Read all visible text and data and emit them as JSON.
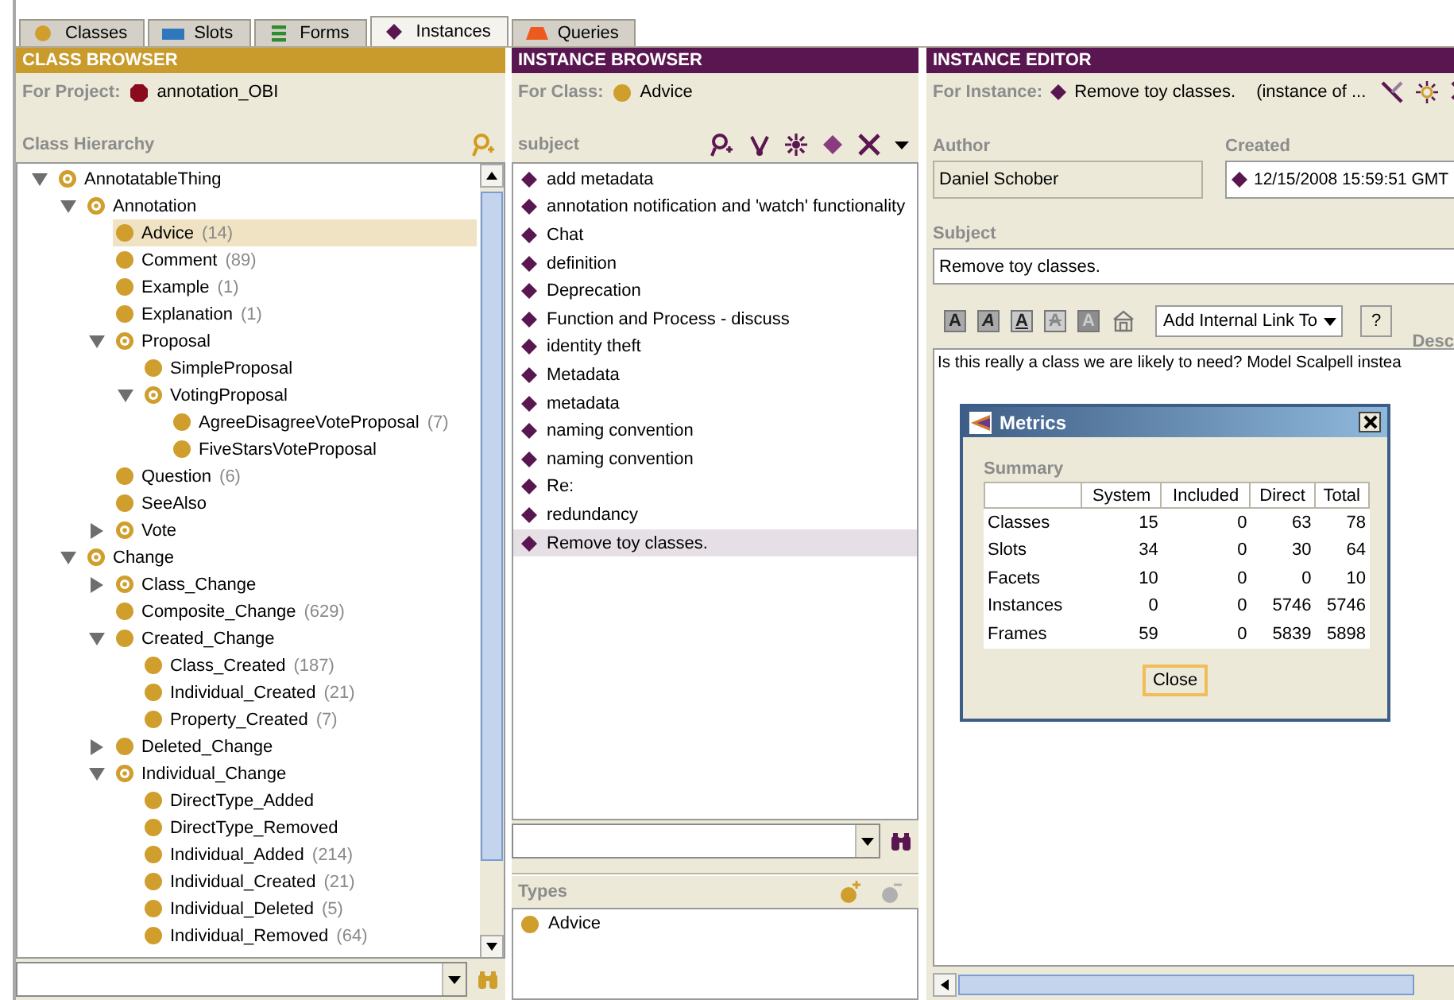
{
  "tabs": [
    {
      "label": "Classes",
      "kind": "classes",
      "selected": false
    },
    {
      "label": "Slots",
      "kind": "slots",
      "selected": false
    },
    {
      "label": "Forms",
      "kind": "forms",
      "selected": false
    },
    {
      "label": "Instances",
      "kind": "instances",
      "selected": true
    },
    {
      "label": "Queries",
      "kind": "queries",
      "selected": false
    }
  ],
  "class_browser": {
    "title": "CLASS BROWSER",
    "project_label": "For Project:",
    "project": "annotation_OBI",
    "hierarchy_label": "Class Hierarchy",
    "tree": [
      {
        "name": "AnnotatableThing",
        "abstract": true,
        "expanded": true,
        "selected": false,
        "children": [
          {
            "name": "Annotation",
            "abstract": true,
            "expanded": true,
            "selected": false,
            "children": [
              {
                "name": "Advice",
                "count": "(14)",
                "abstract": false,
                "selected": true
              },
              {
                "name": "Comment",
                "count": "(89)",
                "abstract": false,
                "selected": false
              },
              {
                "name": "Example",
                "count": "(1)",
                "abstract": false,
                "selected": false
              },
              {
                "name": "Explanation",
                "count": "(1)",
                "abstract": false,
                "selected": false
              },
              {
                "name": "Proposal",
                "abstract": true,
                "expanded": true,
                "selected": false,
                "children": [
                  {
                    "name": "SimpleProposal",
                    "abstract": false,
                    "selected": false
                  },
                  {
                    "name": "VotingProposal",
                    "abstract": true,
                    "expanded": true,
                    "selected": false,
                    "children": [
                      {
                        "name": "AgreeDisagreeVoteProposal",
                        "count": "(7)",
                        "abstract": false,
                        "selected": false
                      },
                      {
                        "name": "FiveStarsVoteProposal",
                        "abstract": false,
                        "selected": false
                      }
                    ]
                  }
                ]
              },
              {
                "name": "Question",
                "count": "(6)",
                "abstract": false,
                "selected": false
              },
              {
                "name": "SeeAlso",
                "abstract": false,
                "selected": false
              },
              {
                "name": "Vote",
                "abstract": true,
                "expanded": false,
                "selected": false
              }
            ]
          },
          {
            "name": "Change",
            "abstract": true,
            "expanded": true,
            "selected": false,
            "children": [
              {
                "name": "Class_Change",
                "abstract": true,
                "expanded": false,
                "selected": false
              },
              {
                "name": "Composite_Change",
                "count": "(629)",
                "abstract": false,
                "selected": false
              },
              {
                "name": "Created_Change",
                "abstract": false,
                "expanded": true,
                "selected": false,
                "children": [
                  {
                    "name": "Class_Created",
                    "count": "(187)",
                    "abstract": false,
                    "selected": false
                  },
                  {
                    "name": "Individual_Created",
                    "count": "(21)",
                    "abstract": false,
                    "selected": false
                  },
                  {
                    "name": "Property_Created",
                    "count": "(7)",
                    "abstract": false,
                    "selected": false
                  }
                ]
              },
              {
                "name": "Deleted_Change",
                "abstract": false,
                "expanded": false,
                "selected": false
              },
              {
                "name": "Individual_Change",
                "abstract": true,
                "expanded": true,
                "selected": false,
                "children": [
                  {
                    "name": "DirectType_Added",
                    "abstract": false,
                    "selected": false
                  },
                  {
                    "name": "DirectType_Removed",
                    "abstract": false,
                    "selected": false
                  },
                  {
                    "name": "Individual_Added",
                    "count": "(214)",
                    "abstract": false,
                    "selected": false
                  },
                  {
                    "name": "Individual_Created",
                    "count": "(21)",
                    "abstract": false,
                    "selected": false
                  },
                  {
                    "name": "Individual_Deleted",
                    "count": "(5)",
                    "abstract": false,
                    "selected": false
                  },
                  {
                    "name": "Individual_Removed",
                    "count": "(64)",
                    "abstract": false,
                    "selected": false
                  }
                ]
              }
            ]
          }
        ]
      }
    ]
  },
  "instance_browser": {
    "title": "INSTANCE BROWSER",
    "class_label": "For Class:",
    "class_name": "Advice",
    "list_label": "subject",
    "items": [
      {
        "label": "add metadata",
        "selected": false
      },
      {
        "label": "annotation notification and 'watch' functionality",
        "selected": false
      },
      {
        "label": "Chat",
        "selected": false
      },
      {
        "label": "definition",
        "selected": false
      },
      {
        "label": "Deprecation",
        "selected": false
      },
      {
        "label": "Function and Process - discuss",
        "selected": false
      },
      {
        "label": "identity theft",
        "selected": false
      },
      {
        "label": "Metadata",
        "selected": false
      },
      {
        "label": "metadata",
        "selected": false
      },
      {
        "label": "naming convention",
        "selected": false
      },
      {
        "label": "naming convention",
        "selected": false
      },
      {
        "label": "Re:",
        "selected": false
      },
      {
        "label": "redundancy",
        "selected": false
      },
      {
        "label": "Remove toy classes.",
        "selected": true
      }
    ],
    "types_label": "Types",
    "types": [
      "Advice"
    ]
  },
  "instance_editor": {
    "title": "INSTANCE EDITOR",
    "instance_label": "For Instance:",
    "instance": "Remove toy classes.",
    "instance_of": "(instance of ...",
    "author_label": "Author",
    "author": "Daniel Schober",
    "created_label": "Created",
    "created": "12/15/2008 15:59:51 GMT",
    "subject_label": "Subject",
    "subject": "Remove toy classes.",
    "format_buttons": [
      {
        "label": "A",
        "kind": "bold"
      },
      {
        "label": "A",
        "kind": "italic"
      },
      {
        "label": "A",
        "kind": "underline"
      },
      {
        "label": "A",
        "kind": "strike"
      },
      {
        "label": "A",
        "kind": "highlight"
      }
    ],
    "link_dropdown": "Add Internal Link To",
    "help_button": "?",
    "description_label": "Desc",
    "description": "Is this really a class we are likely to need? Model Scalpell instea"
  },
  "metrics_dialog": {
    "title": "Metrics",
    "section": "Summary",
    "columns": [
      "System",
      "Included",
      "Direct",
      "Total"
    ],
    "rows": [
      {
        "label": "Classes",
        "values": [
          "15",
          "0",
          "63",
          "78"
        ]
      },
      {
        "label": "Slots",
        "values": [
          "34",
          "0",
          "30",
          "64"
        ]
      },
      {
        "label": "Facets",
        "values": [
          "10",
          "0",
          "0",
          "10"
        ]
      },
      {
        "label": "Instances",
        "values": [
          "0",
          "0",
          "5746",
          "5746"
        ]
      },
      {
        "label": "Frames",
        "values": [
          "59",
          "0",
          "5839",
          "5898"
        ]
      }
    ],
    "close_button": "Close"
  }
}
